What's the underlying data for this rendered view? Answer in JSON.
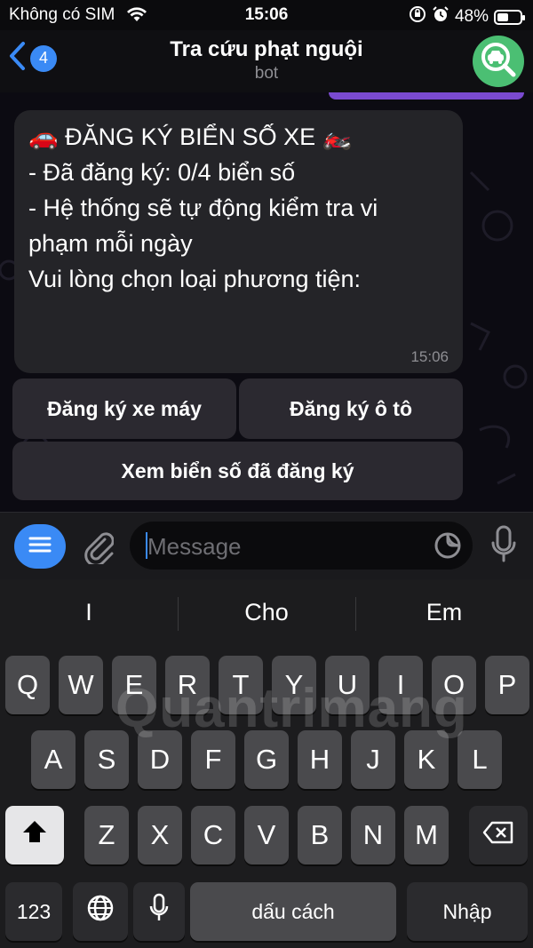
{
  "status": {
    "carrier": "Không có SIM",
    "time": "15:06",
    "battery": "48%",
    "battery_level": 0.48
  },
  "header": {
    "back_count": "4",
    "title": "Tra cứu phạt nguội",
    "subtitle": "bot"
  },
  "message": {
    "lines": [
      "🚗 ĐĂNG KÝ BIỂN SỐ XE 🏍️",
      "",
      "- Đã đăng ký: 0/4 biển số",
      "- Hệ thống sẽ tự động kiểm tra vi",
      "phạm mỗi ngày",
      "",
      "Vui lòng chọn loại phương tiện:"
    ],
    "time": "15:06"
  },
  "keyboard_buttons": {
    "motorbike": "Đăng ký xe máy",
    "car": "Đăng ký ô tô",
    "view": "Xem biển số đã đăng ký"
  },
  "input": {
    "placeholder": "Message"
  },
  "suggestions": [
    "I",
    "Cho",
    "Em"
  ],
  "keys": {
    "row1": [
      "Q",
      "W",
      "E",
      "R",
      "T",
      "Y",
      "U",
      "I",
      "O",
      "P"
    ],
    "row2": [
      "A",
      "S",
      "D",
      "F",
      "G",
      "H",
      "J",
      "K",
      "L"
    ],
    "row3": [
      "Z",
      "X",
      "C",
      "V",
      "B",
      "N",
      "M"
    ],
    "numbers": "123",
    "space": "dấu cách",
    "return": "Nhập"
  },
  "watermark": "Quantrimang",
  "colors": {
    "accent": "#3a8af5",
    "avatar": "#4bbf73",
    "bubble": "#242428"
  }
}
